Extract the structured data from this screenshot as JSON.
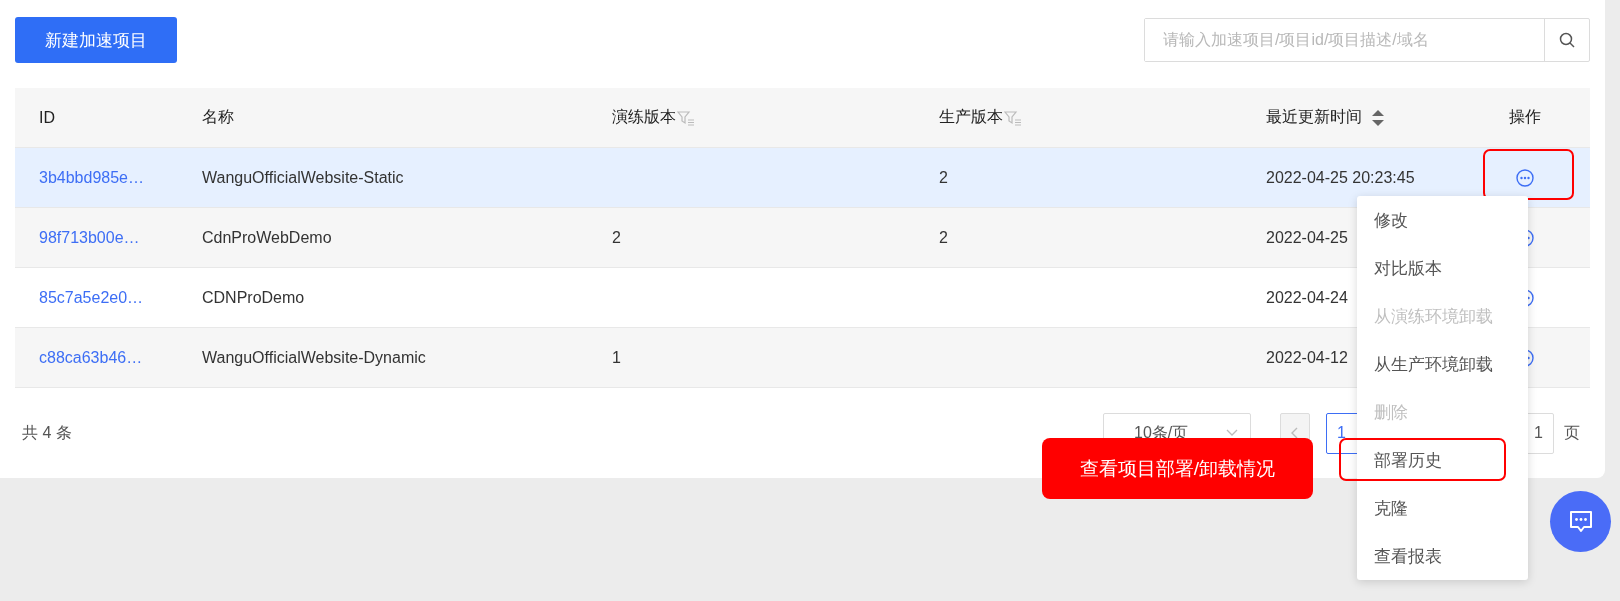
{
  "toolbar": {
    "create_button": "新建加速项目",
    "search": {
      "placeholder": "请输入加速项目/项目id/项目描述/域名"
    }
  },
  "table": {
    "columns": [
      {
        "label": "ID",
        "kind": "plain"
      },
      {
        "label": "名称",
        "kind": "plain"
      },
      {
        "label": "演练版本",
        "kind": "filter"
      },
      {
        "label": "生产版本",
        "kind": "filter"
      },
      {
        "label": "最近更新时间",
        "kind": "sort"
      },
      {
        "label": "操作",
        "kind": "center"
      }
    ],
    "rows": [
      {
        "id": "3b4bbd985e…",
        "name": "WanguOfficialWebsite-Static",
        "production": "2",
        "updated": "2022-04-25 20:23:45",
        "highlighted": true
      },
      {
        "id": "98f713b00e…",
        "name": "CdnProWebDemo",
        "staging": "2",
        "production": "2",
        "updated": "2022-04-25",
        "highlighted": false
      },
      {
        "id": "85c7a5e2e0…",
        "name": "CDNProDemo",
        "updated": "2022-04-24",
        "highlighted": false
      },
      {
        "id": "c88ca63b46…",
        "name": "WanguOfficialWebsite-Dynamic",
        "staging": "1",
        "updated": "2022-04-12",
        "highlighted": false
      }
    ]
  },
  "menu": {
    "items": [
      {
        "label": "修改",
        "disabled": false
      },
      {
        "label": "对比版本",
        "disabled": false
      },
      {
        "label": "从演练环境卸载",
        "disabled": true
      },
      {
        "label": "从生产环境卸载",
        "disabled": false
      },
      {
        "label": "删除",
        "disabled": true
      },
      {
        "label": "部署历史",
        "disabled": false
      },
      {
        "label": "克隆",
        "disabled": false
      },
      {
        "label": "查看报表",
        "disabled": false
      }
    ]
  },
  "annotation": {
    "text": "查看项目部署/卸载情况"
  },
  "footer": {
    "total": "共 4 条",
    "page_size": "10条/页",
    "current_page": "1",
    "goto_value": "1",
    "goto_suffix": "页"
  }
}
